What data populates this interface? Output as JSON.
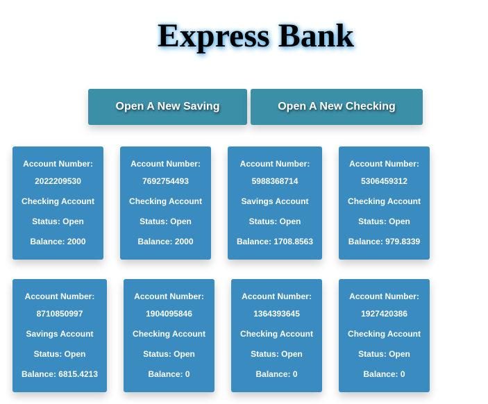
{
  "title": "Express Bank",
  "buttons": {
    "open_saving": "Open A New Saving",
    "open_checking": "Open A New Checking"
  },
  "colors": {
    "button_bg": "#3b8fa7",
    "card_bg": "#3a8bc0",
    "title_glow": "#4aa8e0"
  },
  "accounts": [
    {
      "number_label": "Account Number:",
      "number": "2022209530",
      "type": "Checking Account",
      "status": "Status: Open",
      "balance": "Balance: 2000"
    },
    {
      "number_label": "Account Number:",
      "number": "7692754493",
      "type": "Checking Account",
      "status": "Status: Open",
      "balance": "Balance: 2000"
    },
    {
      "number_label": "Account Number:",
      "number": "5988368714",
      "type": "Savings Account",
      "status": "Status: Open",
      "balance": "Balance: 1708.8563"
    },
    {
      "number_label": "Account Number:",
      "number": "5306459312",
      "type": "Checking Account",
      "status": "Status: Open",
      "balance": "Balance: 979.8339"
    },
    {
      "number_label": "Account Number:",
      "number": "8710850997",
      "type": "Savings Account",
      "status": "Status: Open",
      "balance": "Balance: 6815.4213"
    },
    {
      "number_label": "Account Number:",
      "number": "1904095846",
      "type": "Checking Account",
      "status": "Status: Open",
      "balance": "Balance: 0"
    },
    {
      "number_label": "Account Number:",
      "number": "1364393645",
      "type": "Checking Account",
      "status": "Status: Open",
      "balance": "Balance: 0"
    },
    {
      "number_label": "Account Number:",
      "number": "1927420386",
      "type": "Checking Account",
      "status": "Status: Open",
      "balance": "Balance: 0"
    }
  ]
}
